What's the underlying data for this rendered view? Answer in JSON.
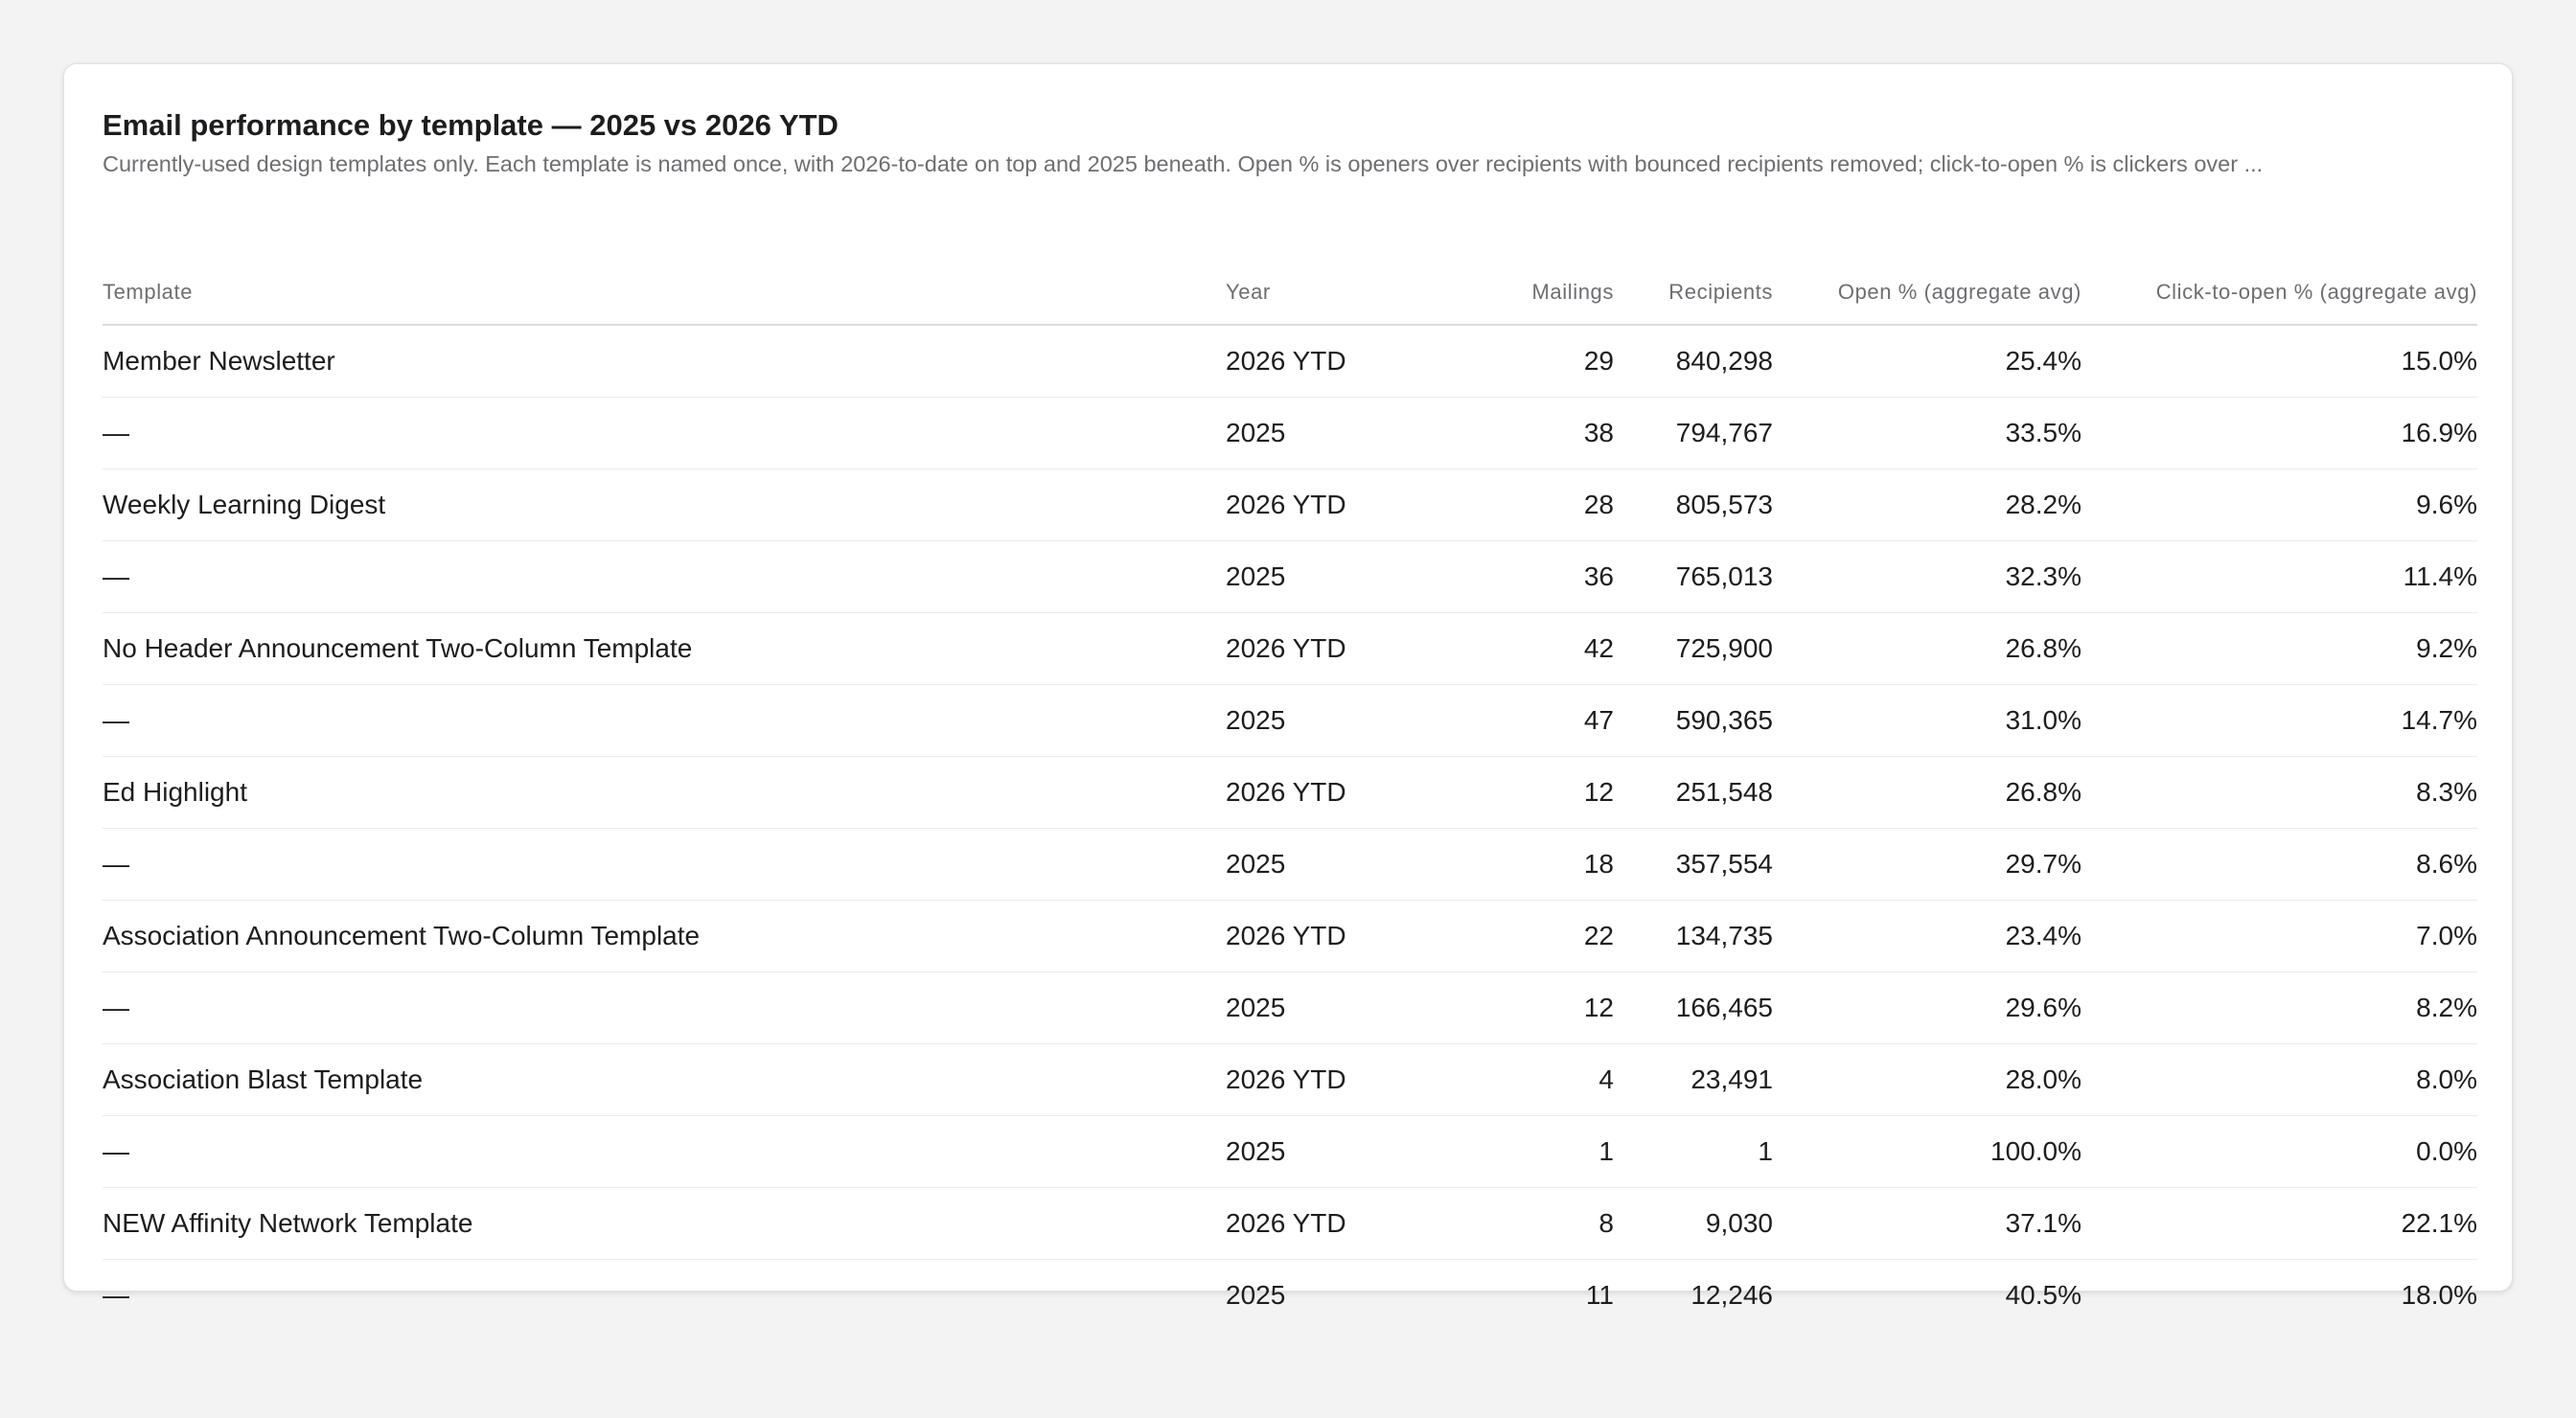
{
  "report": {
    "title": "Email performance by template — 2025 vs 2026 YTD",
    "subtitle": "Currently-used design templates only. Each template is named once, with 2026-to-date on top and 2025 beneath. Open % is openers over recipients with bounced recipients removed; click-to-open % is clickers over ..."
  },
  "table": {
    "columns": {
      "template": "Template",
      "year": "Year",
      "mailings": "Mailings",
      "recipients": "Recipients",
      "open": "Open % (aggregate avg)",
      "cto": "Click-to-open % (aggregate avg)"
    },
    "rows": [
      {
        "template": "Member Newsletter",
        "year": "2026 YTD",
        "mailings": "29",
        "recipients": "840,298",
        "open": "25.4%",
        "cto": "15.0%"
      },
      {
        "template": "—",
        "year": "2025",
        "mailings": "38",
        "recipients": "794,767",
        "open": "33.5%",
        "cto": "16.9%"
      },
      {
        "template": "Weekly Learning Digest",
        "year": "2026 YTD",
        "mailings": "28",
        "recipients": "805,573",
        "open": "28.2%",
        "cto": "9.6%"
      },
      {
        "template": "—",
        "year": "2025",
        "mailings": "36",
        "recipients": "765,013",
        "open": "32.3%",
        "cto": "11.4%"
      },
      {
        "template": "No Header Announcement Two-Column Template",
        "year": "2026 YTD",
        "mailings": "42",
        "recipients": "725,900",
        "open": "26.8%",
        "cto": "9.2%"
      },
      {
        "template": "—",
        "year": "2025",
        "mailings": "47",
        "recipients": "590,365",
        "open": "31.0%",
        "cto": "14.7%"
      },
      {
        "template": "Ed Highlight",
        "year": "2026 YTD",
        "mailings": "12",
        "recipients": "251,548",
        "open": "26.8%",
        "cto": "8.3%"
      },
      {
        "template": "—",
        "year": "2025",
        "mailings": "18",
        "recipients": "357,554",
        "open": "29.7%",
        "cto": "8.6%"
      },
      {
        "template": "Association Announcement Two-Column Template",
        "year": "2026 YTD",
        "mailings": "22",
        "recipients": "134,735",
        "open": "23.4%",
        "cto": "7.0%"
      },
      {
        "template": "—",
        "year": "2025",
        "mailings": "12",
        "recipients": "166,465",
        "open": "29.6%",
        "cto": "8.2%"
      },
      {
        "template": "Association Blast Template",
        "year": "2026 YTD",
        "mailings": "4",
        "recipients": "23,491",
        "open": "28.0%",
        "cto": "8.0%"
      },
      {
        "template": "—",
        "year": "2025",
        "mailings": "1",
        "recipients": "1",
        "open": "100.0%",
        "cto": "0.0%"
      },
      {
        "template": "NEW Affinity Network Template",
        "year": "2026 YTD",
        "mailings": "8",
        "recipients": "9,030",
        "open": "37.1%",
        "cto": "22.1%"
      },
      {
        "template": "—",
        "year": "2025",
        "mailings": "11",
        "recipients": "12,246",
        "open": "40.5%",
        "cto": "18.0%"
      }
    ]
  }
}
